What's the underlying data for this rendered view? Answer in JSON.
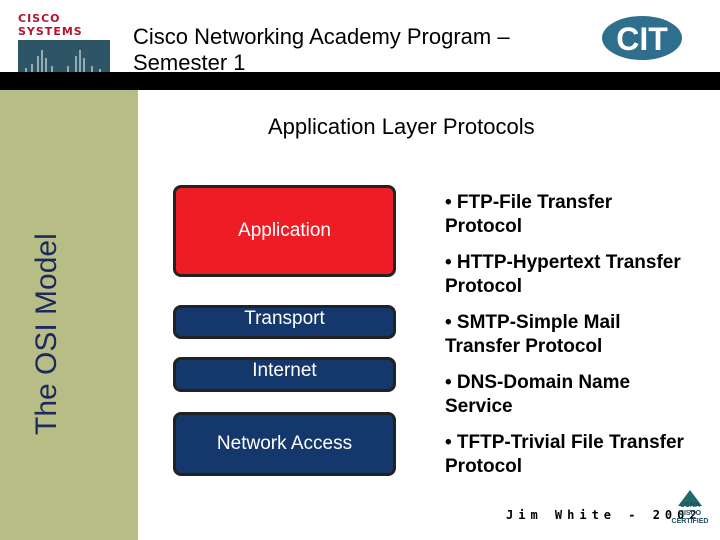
{
  "header": {
    "logo_text": "Cisco Systems",
    "title": "Cisco Networking Academy Program – Semester 1",
    "right_logo_text": "CIT"
  },
  "sidebar": {
    "label": "The OSI Model"
  },
  "main": {
    "heading": "Application Layer Protocols",
    "layers": [
      {
        "label": "Application",
        "color": "#ee1c25"
      },
      {
        "label": "Transport",
        "color": "#14386b"
      },
      {
        "label": "Internet",
        "color": "#14386b"
      },
      {
        "label": "Network Access",
        "color": "#14386b"
      }
    ],
    "protocols": [
      "• FTP-File Transfer Protocol",
      "• HTTP-Hypertext Transfer Protocol",
      "• SMTP-Simple Mail Transfer Protocol",
      "• DNS-Domain Name Service",
      "• TFTP-Trivial File Transfer Protocol"
    ]
  },
  "footer": {
    "author": "Jim White - 2002",
    "badge_text": "CCNA CISCO CERTIFIED"
  }
}
